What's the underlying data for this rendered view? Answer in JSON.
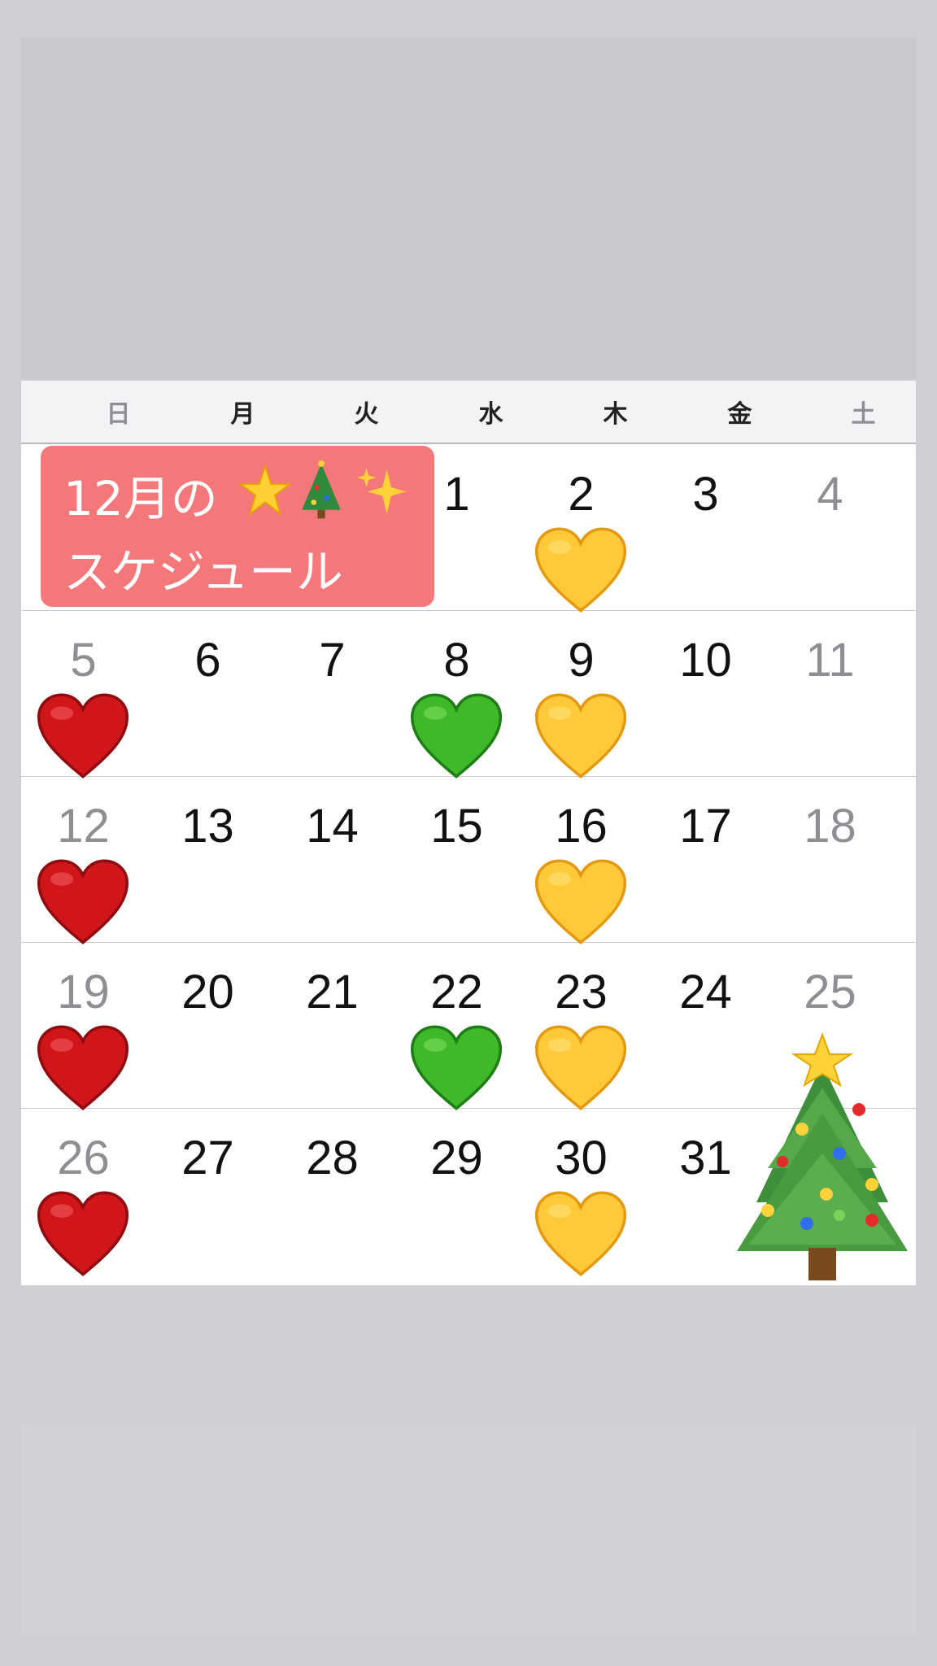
{
  "title": {
    "line1": "12月の",
    "line2": "スケジュール"
  },
  "weekdays": [
    "日",
    "月",
    "火",
    "水",
    "木",
    "金",
    "土"
  ],
  "weeks": [
    [
      "",
      "",
      "",
      "1",
      "2",
      "3",
      "4"
    ],
    [
      "5",
      "6",
      "7",
      "8",
      "9",
      "10",
      "11"
    ],
    [
      "12",
      "13",
      "14",
      "15",
      "16",
      "17",
      "18"
    ],
    [
      "19",
      "20",
      "21",
      "22",
      "23",
      "24",
      "25"
    ],
    [
      "26",
      "27",
      "28",
      "29",
      "30",
      "31",
      ""
    ]
  ],
  "heart_markers": [
    {
      "day": "2",
      "color": "yellow"
    },
    {
      "day": "5",
      "color": "red"
    },
    {
      "day": "8",
      "color": "green"
    },
    {
      "day": "9",
      "color": "yellow"
    },
    {
      "day": "12",
      "color": "red"
    },
    {
      "day": "16",
      "color": "yellow"
    },
    {
      "day": "19",
      "color": "red"
    },
    {
      "day": "22",
      "color": "green"
    },
    {
      "day": "23",
      "color": "yellow"
    },
    {
      "day": "26",
      "color": "red"
    },
    {
      "day": "30",
      "color": "yellow"
    }
  ],
  "colors": {
    "background": "#cfced3",
    "title_badge": "#f47779",
    "weekend_text": "#8e8e93",
    "heart_red": "#d0161b",
    "heart_yellow": "#ffc93a",
    "heart_green": "#3fb82a"
  },
  "icons": [
    "star-icon",
    "christmas-tree-icon",
    "sparkles-icon",
    "heart-icon",
    "christmas-tree-icon"
  ]
}
